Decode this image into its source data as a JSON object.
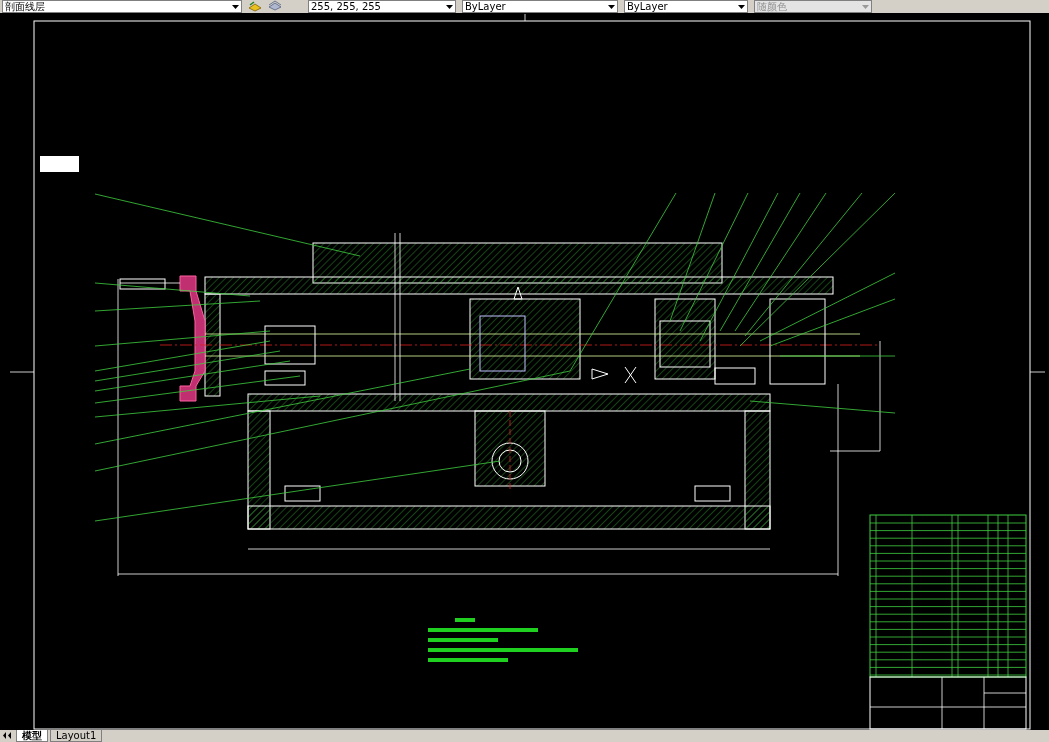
{
  "toolbar": {
    "layer": {
      "value": "剖面线层"
    },
    "color": {
      "value": "255, 255, 255"
    },
    "linetype": {
      "value": "ByLayer"
    },
    "lineweight": {
      "value": "ByLayer"
    },
    "plot_style": {
      "value": "随颜色",
      "disabled": true
    }
  },
  "tabs": [
    {
      "label": "模型",
      "selected": true
    },
    {
      "label": "Layout1",
      "selected": false
    }
  ]
}
